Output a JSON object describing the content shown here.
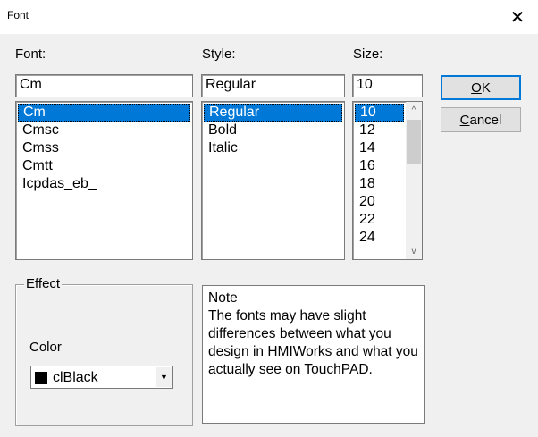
{
  "window": {
    "title": "Font",
    "close_glyph": "✕"
  },
  "font": {
    "label": "Font:",
    "value": "Cm",
    "options": [
      "Cm",
      "Cmsc",
      "Cmss",
      "Cmtt",
      "Icpdas_eb_"
    ],
    "selected": "Cm"
  },
  "style": {
    "label": "Style:",
    "value": "Regular",
    "options": [
      "Regular",
      "Bold",
      "Italic"
    ],
    "selected": "Regular"
  },
  "size": {
    "label": "Size:",
    "value": "10",
    "options": [
      "10",
      "12",
      "14",
      "16",
      "18",
      "20",
      "22",
      "24"
    ],
    "selected": "10",
    "scroll_up": "^",
    "scroll_down": "v"
  },
  "buttons": {
    "ok_mnemonic": "O",
    "ok_rest": "K",
    "cancel_mnemonic": "C",
    "cancel_rest": "ancel"
  },
  "effect": {
    "label": "Effect",
    "color_label": "Color",
    "color_value": "clBlack",
    "color_swatch": "#000000",
    "dropdown_glyph": "▼"
  },
  "note": {
    "heading": "Note",
    "text": "The fonts may have slight differences between what you design in HMIWorks and what you actually see on TouchPAD."
  },
  "colors": {
    "selection": "#0078d7",
    "accent_border": "#0078d7"
  }
}
